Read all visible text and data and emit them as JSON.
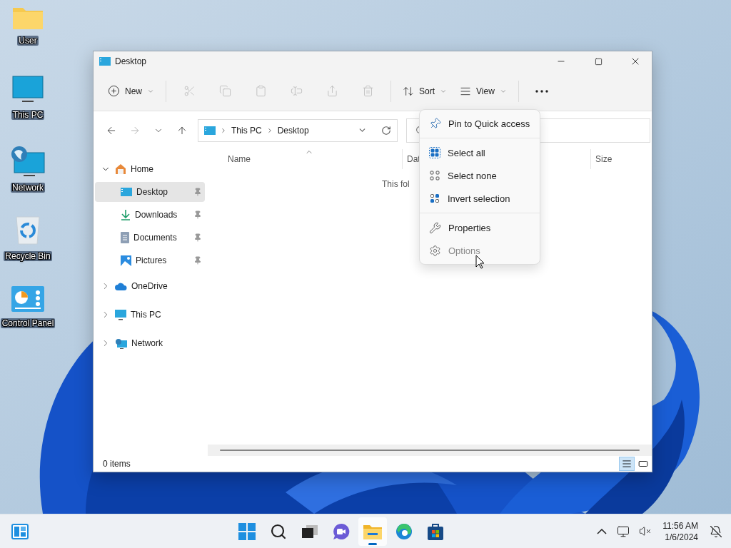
{
  "desktop_icons": [
    {
      "label": "User",
      "kind": "folder"
    },
    {
      "label": "This PC",
      "kind": "pc"
    },
    {
      "label": "Network",
      "kind": "network"
    },
    {
      "label": "Recycle Bin",
      "kind": "recycle"
    },
    {
      "label": "Control Panel",
      "kind": "control_panel"
    }
  ],
  "window": {
    "title": "Desktop"
  },
  "command_bar": {
    "new": {
      "label": "New"
    },
    "actions": [
      {
        "kind": "cut",
        "disabled": true
      },
      {
        "kind": "copy",
        "disabled": true
      },
      {
        "kind": "paste",
        "disabled": true
      },
      {
        "kind": "rename",
        "disabled": true
      },
      {
        "kind": "share",
        "disabled": true
      },
      {
        "kind": "delete",
        "disabled": true
      }
    ],
    "sort": {
      "label": "Sort"
    },
    "view": {
      "label": "View"
    }
  },
  "address_bar": {
    "path": [
      "This PC",
      "Desktop"
    ]
  },
  "navigation": [
    {
      "label": "Home",
      "kind": "home",
      "expanded": true,
      "selected": false,
      "children": [
        {
          "label": "Desktop",
          "kind": "desktop",
          "selected": true,
          "pinned": true
        },
        {
          "label": "Downloads",
          "kind": "downloads",
          "selected": false,
          "pinned": true
        },
        {
          "label": "Documents",
          "kind": "documents",
          "selected": false,
          "pinned": true
        },
        {
          "label": "Pictures",
          "kind": "pictures",
          "selected": false,
          "pinned": true
        }
      ]
    },
    {
      "label": "OneDrive",
      "kind": "cloud",
      "expanded": false,
      "selected": false
    },
    {
      "label": "This PC",
      "kind": "pc",
      "expanded": false,
      "selected": false
    },
    {
      "label": "Network",
      "kind": "network",
      "expanded": false,
      "selected": false
    }
  ],
  "columns": [
    {
      "label": "Name",
      "sorted": true
    },
    {
      "label": "Dat",
      "sorted": false
    },
    {
      "label": "Size",
      "sorted": false
    }
  ],
  "empty_message": "This fol",
  "status_bar": {
    "item_count": "0 items",
    "views": [
      {
        "kind": "details",
        "selected": true
      },
      {
        "kind": "tiles",
        "selected": false
      }
    ]
  },
  "context_menu": {
    "groups": [
      [
        {
          "label": "Pin to Quick access",
          "kind": "pin",
          "disabled": false
        }
      ],
      [
        {
          "label": "Select all",
          "kind": "select_all",
          "disabled": false
        },
        {
          "label": "Select none",
          "kind": "select_none",
          "disabled": false
        },
        {
          "label": "Invert selection",
          "kind": "invert",
          "disabled": false
        }
      ],
      [
        {
          "label": "Properties",
          "kind": "properties",
          "disabled": false
        },
        {
          "label": "Options",
          "kind": "options",
          "disabled": true
        }
      ]
    ]
  },
  "taskbar": {
    "apps": [
      {
        "kind": "start",
        "active": false
      },
      {
        "kind": "search",
        "active": false
      },
      {
        "kind": "task_view",
        "active": false
      },
      {
        "kind": "chat",
        "active": false
      },
      {
        "kind": "explorer",
        "active": true
      },
      {
        "kind": "edge",
        "active": false
      },
      {
        "kind": "store",
        "active": false
      }
    ],
    "clock": {
      "time": "11:56 AM",
      "date": "1/6/2024"
    }
  }
}
